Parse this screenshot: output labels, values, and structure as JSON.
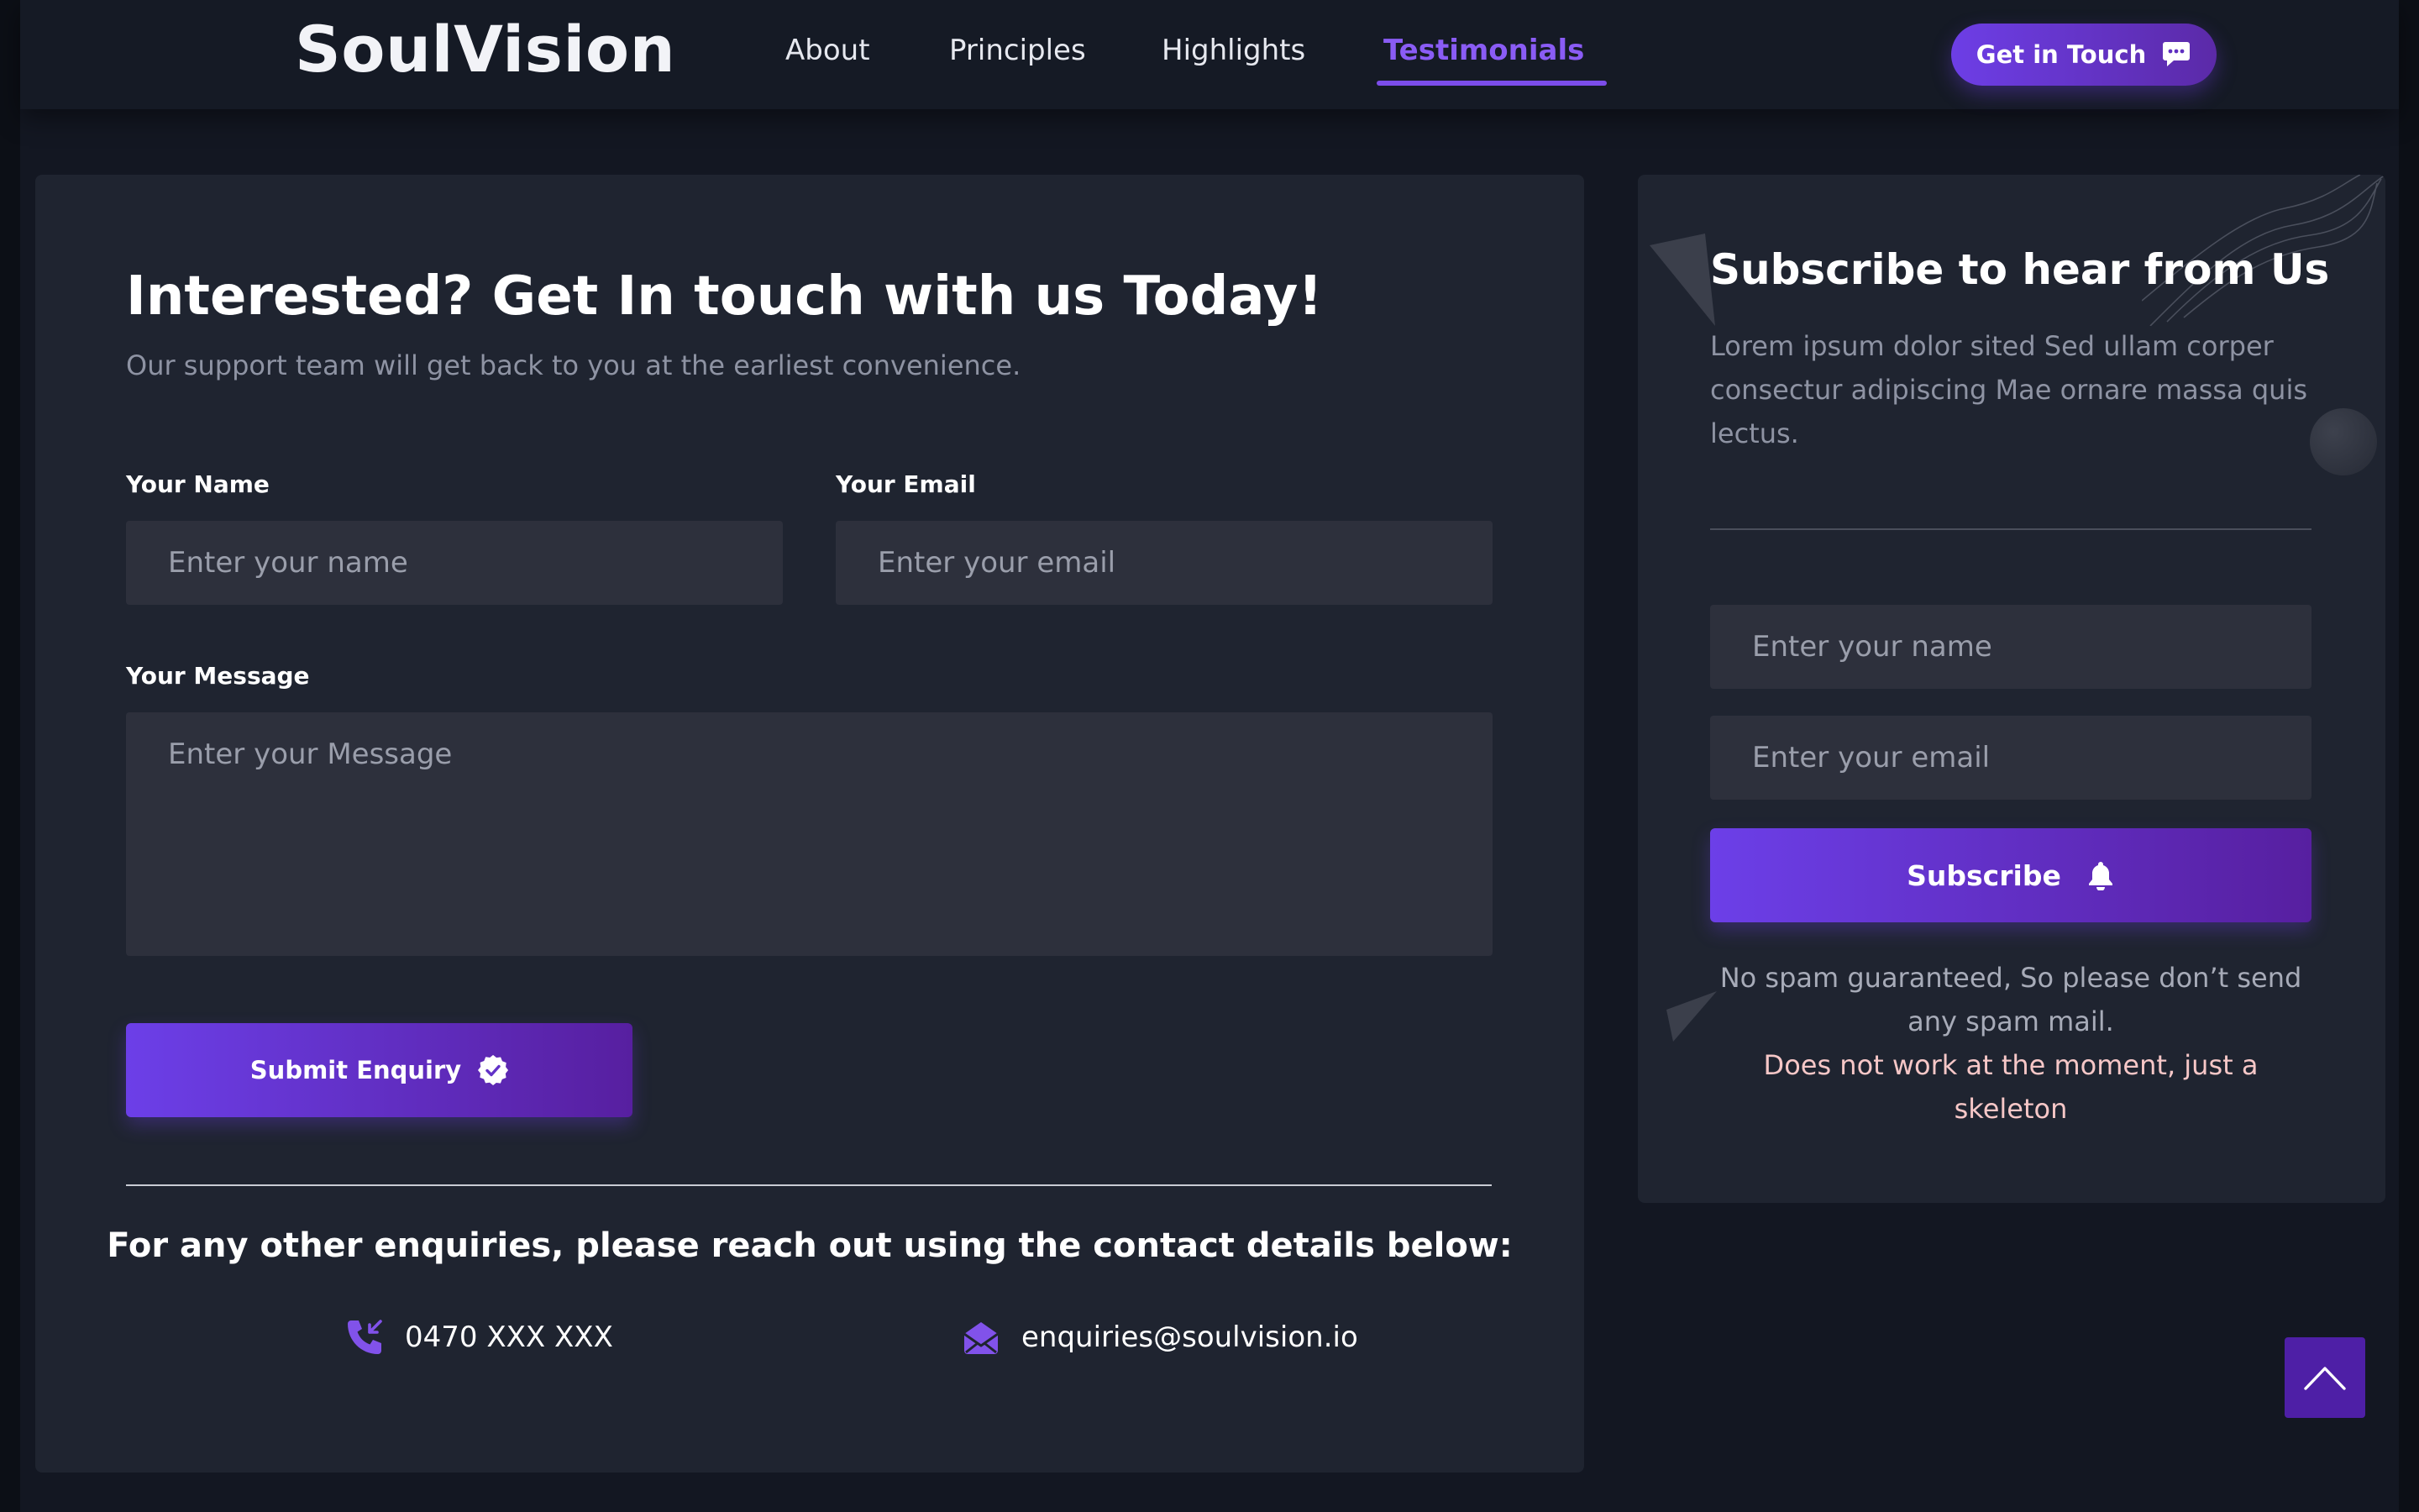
{
  "header": {
    "logo": "SoulVision",
    "nav": [
      "About",
      "Principles",
      "Highlights",
      "Testimonials"
    ],
    "active_nav": "Testimonials",
    "cta_label": "Get in Touch",
    "cta_icon": "chat-bubble-icon"
  },
  "enquiry": {
    "title": "Interested? Get In touch with us Today!",
    "subtitle": "Our support team will get back to you at the earliest convenience.",
    "name_label": "Your Name",
    "name_placeholder": "Enter your name",
    "email_label": "Your Email",
    "email_placeholder": "Enter your email",
    "message_label": "Your Message",
    "message_placeholder": "Enter your Message",
    "submit_label": "Submit Enquiry",
    "submit_icon": "check-badge-icon",
    "contact_title": "For any other enquiries, please reach out using the contact details below:",
    "phone": "0470 XXX XXX",
    "phone_icon": "phone-incoming-icon",
    "email": "enquiries@soulvision.io",
    "email_icon": "envelope-open-icon"
  },
  "subscribe": {
    "title": "Subscribe to hear from Us",
    "description": "Lorem ipsum dolor sited Sed ullam corper consectur adipiscing Mae ornare massa quis lectus.",
    "name_placeholder": "Enter your name",
    "email_placeholder": "Enter your email",
    "button_label": "Subscribe",
    "button_icon": "bell-icon",
    "note": "No spam guaranteed, So please don’t send any spam mail.",
    "warning": "Does not work at the moment, just a skeleton"
  },
  "colors": {
    "background": "#131722",
    "card": "#1f2430",
    "accent": "#7c4dea",
    "input": "#2d303c",
    "warning_text": "#f6c7c7"
  },
  "scroll_top_icon": "chevron-up-icon"
}
